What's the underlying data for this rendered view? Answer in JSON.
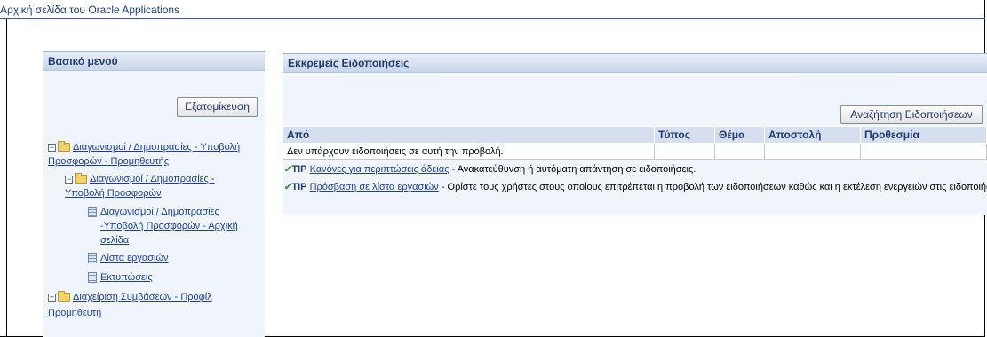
{
  "app": {
    "title": "Αρχική σελίδα του Oracle Applications"
  },
  "main_menu": {
    "header": "Βασικό μενού",
    "personalize_label": "Εξατομίκευση",
    "items": [
      {
        "line1": "Διαγωνισμοί / Δημοπρασίες - Υποβολή",
        "line2": "Προσφορών - Προμηθευτής"
      },
      {
        "line1": "Διαγωνισμοί / Δημοπρασίες -",
        "line2": "Υποβολή Προσφορών"
      },
      {
        "line1": "Διαγωνισμοί / Δημοπρασίες",
        "line2": "-Υποβολή Προσφορών - Αρχική",
        "line3": "σελίδα"
      },
      {
        "line1": "Λίστα εργασιών"
      },
      {
        "line1": "Εκτυπώσεις"
      },
      {
        "line1": "Διαχείριση Συμβάσεων - Προφίλ",
        "line2": "Προμηθευτή"
      }
    ]
  },
  "notifications": {
    "header": "Εκκρεμείς Ειδοποιήσεις",
    "search_label": "Αναζήτηση Ειδοποιήσεων",
    "columns": [
      "Από",
      "Τύπος",
      "Θέμα",
      "Αποστολή",
      "Προθεσμία"
    ],
    "empty_message": "Δεν υπάρχουν ειδοποιήσεις σε αυτή την προβολή.",
    "tips": [
      {
        "label": "TIP",
        "link": "Κανόνες για περιπτώσεις άδειας",
        "text": " - Ανακατεύθυνση ή αυτόματη απάντηση σε ειδοποιήσεις."
      },
      {
        "label": "TIP",
        "link": "Πρόσβαση σε λίστα εργασιών",
        "text": " - Ορίστε τους χρήστες στους οποίους επιτρέπεται η προβολή των ειδοποιήσεων καθώς και η εκτέλεση ενεργειών στις ειδοποιήσεις."
      }
    ]
  }
}
